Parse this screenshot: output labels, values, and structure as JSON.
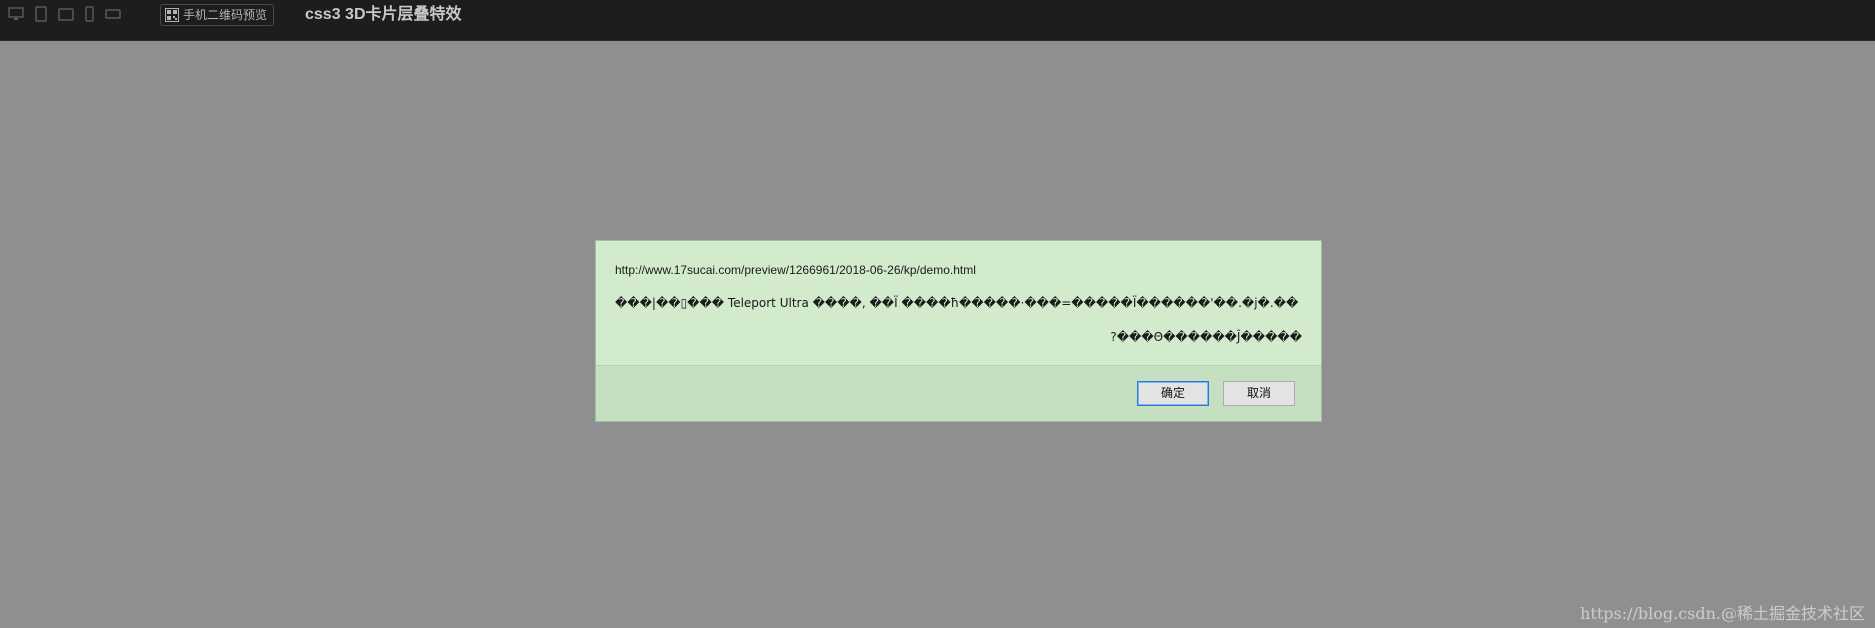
{
  "toolbar": {
    "device_icons": [
      "desktop-icon",
      "tablet-portrait-icon",
      "tablet-landscape-icon",
      "phone-portrait-icon",
      "phone-landscape-icon"
    ],
    "qr_button_label": "手机二维码预览",
    "page_title": "css3 3D卡片层叠特效"
  },
  "dialog": {
    "url": "http://www.17sucai.com/preview/1266961/2018-06-26/kp/demo.html",
    "message_line1": "���|��▯��� Teleport Ultra ����, ��Ï ����ħ�����·���=�����Ï������'��.�j�.��",
    "message_line2": "?���Θ������Ĵ�����",
    "ok_label": "确定",
    "cancel_label": "取消"
  },
  "watermark": "https://blog.csdn.@稀土掘金技术社区",
  "colors": {
    "topbar_bg": "#1d1d1f",
    "page_bg": "#8f8f91",
    "dialog_bg": "#d1ebcc",
    "dialog_footer_bg": "#c5e0c0",
    "ok_button_border": "#2a78d3"
  }
}
